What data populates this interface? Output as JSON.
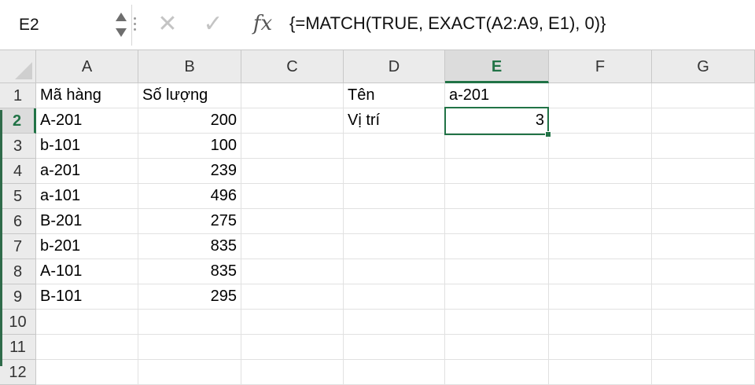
{
  "namebox": {
    "value": "E2"
  },
  "formula_bar": {
    "cancel_icon": "close-icon",
    "enter_icon": "check-icon",
    "fx_label": "fx",
    "formula": "{=MATCH(TRUE, EXACT(A2:A9, E1), 0)}"
  },
  "columns": [
    "A",
    "B",
    "C",
    "D",
    "E",
    "F",
    "G"
  ],
  "active_column": "E",
  "rows": [
    "1",
    "2",
    "3",
    "4",
    "5",
    "6",
    "7",
    "8",
    "9",
    "10",
    "11",
    "12"
  ],
  "active_row": "2",
  "cells": {
    "A": [
      "Mã hàng",
      "A-201",
      "b-101",
      "a-201",
      "a-101",
      "B-201",
      "b-201",
      "A-101",
      "B-101",
      "",
      "",
      ""
    ],
    "B": [
      "Số lượng",
      "200",
      "100",
      "239",
      "496",
      "275",
      "835",
      "835",
      "295",
      "",
      "",
      ""
    ],
    "C": [
      "",
      "",
      "",
      "",
      "",
      "",
      "",
      "",
      "",
      "",
      "",
      ""
    ],
    "D": [
      "Tên",
      "Vị trí",
      "",
      "",
      "",
      "",
      "",
      "",
      "",
      "",
      "",
      ""
    ],
    "E": [
      "a-201",
      "3",
      "",
      "",
      "",
      "",
      "",
      "",
      "",
      "",
      "",
      ""
    ],
    "F": [
      "",
      "",
      "",
      "",
      "",
      "",
      "",
      "",
      "",
      "",
      "",
      ""
    ],
    "G": [
      "",
      "",
      "",
      "",
      "",
      "",
      "",
      "",
      "",
      "",
      "",
      ""
    ]
  },
  "selected_cell": "E2",
  "colors": {
    "accent": "#217346",
    "header_bg": "#ebebeb",
    "grid_line": "#e1e1e1"
  }
}
